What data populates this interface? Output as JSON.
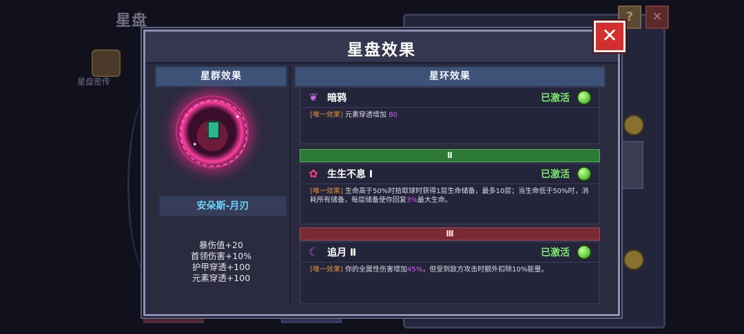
{
  "background": {
    "page_title": "星盘",
    "left_icon_label": "星盘密传",
    "help_icon": "question-mark",
    "close_icon": "x-mark"
  },
  "modal": {
    "title": "星盘效果",
    "close_icon": "x-mark",
    "left": {
      "header": "星群效果",
      "constellation_name": "安朵斯-月刃",
      "stats": [
        "暴伤值+20",
        "首领伤害+10%",
        "护甲穿透+100",
        "元素穿透+100"
      ]
    },
    "right": {
      "header": "星环效果",
      "effects": [
        {
          "icon": "crow-icon",
          "name": "暗鸦",
          "status": "已激活",
          "tag": "[唯一效果]",
          "text_before": "元素穿透增加",
          "highlight": "80",
          "text_after": ""
        },
        {
          "tier": "Ⅱ",
          "icon": "flower-icon",
          "name": "生生不息 Ⅰ",
          "status": "已激活",
          "tag": "[唯一效果]",
          "text_before": "生命高于50%时拾取球时获得1层生命储备，最多10层；当生命低于50%时，消耗所有储备，每层储备使你回复",
          "highlight": "3%",
          "text_after": "最大生命。"
        },
        {
          "tier": "Ⅲ",
          "icon": "crescent-moon-icon",
          "name": "追月 Ⅱ",
          "status": "已激活",
          "tag": "[唯一效果]",
          "text_before": "你的全属性伤害增加",
          "highlight": "45%",
          "text_after": "，但受到敌方攻击时额外扣除10%能量。"
        }
      ]
    }
  },
  "colors": {
    "accent_green": "#7ee86e",
    "tag_orange": "#e0903a",
    "highlight_purple": "#d25cf0",
    "tier2_green": "#2d7a38",
    "tier3_red": "#7a2a34",
    "close_red": "#d32f2f",
    "name_cyan": "#6ed3ff"
  }
}
